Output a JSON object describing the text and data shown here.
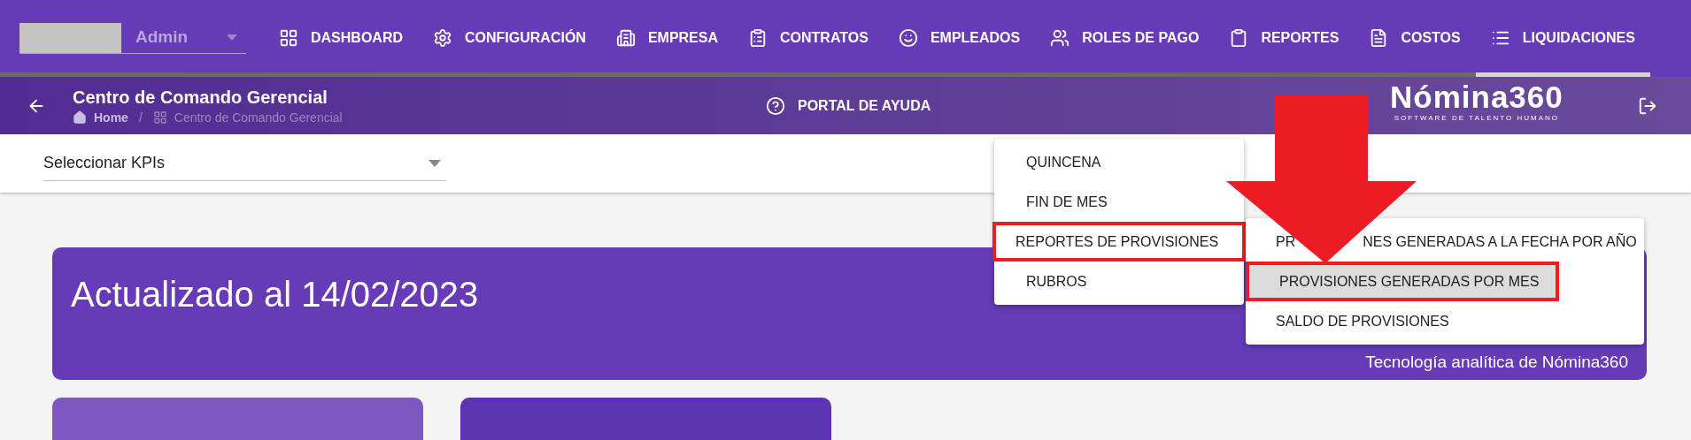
{
  "user_menu": {
    "value": "Admin"
  },
  "nav": [
    {
      "label": "DASHBOARD",
      "selected": false
    },
    {
      "label": "CONFIGURACIÓN",
      "selected": false
    },
    {
      "label": "EMPRESA",
      "selected": false
    },
    {
      "label": "CONTRATOS",
      "selected": false
    },
    {
      "label": "EMPLEADOS",
      "selected": false
    },
    {
      "label": "ROLES DE PAGO",
      "selected": false
    },
    {
      "label": "REPORTES",
      "selected": false
    },
    {
      "label": "COSTOS",
      "selected": false
    },
    {
      "label": "LIQUIDACIONES",
      "selected": true
    }
  ],
  "header": {
    "title": "Centro de Comando Gerencial",
    "breadcrumb": [
      "Home",
      "Centro de Comando Gerencial"
    ],
    "breadcrumb_separator": "/",
    "help": "PORTAL DE AYUDA",
    "logo": "Nómina360",
    "logo_tagline": "SOFTWARE DE TALENTO HUMANO"
  },
  "kpi_select": {
    "placeholder": "Seleccionar KPIs"
  },
  "banner": {
    "title": "Actualizado al 14/02/2023",
    "footer": "Tecnología analítica de Nómina360"
  },
  "menu": [
    {
      "label": "QUINCENA",
      "marked": false
    },
    {
      "label": "FIN DE MES",
      "marked": false
    },
    {
      "label": "REPORTES DE PROVISIONES",
      "marked": true
    },
    {
      "label": "RUBROS",
      "marked": false
    }
  ],
  "submenu": [
    {
      "label_parts": [
        "PR",
        "NES GENERADAS A LA FECHA POR AÑO"
      ],
      "selected": false,
      "marked": false
    },
    {
      "label_parts": [
        "PROVISIONES GENERADAS POR MES"
      ],
      "selected": true,
      "marked": true
    },
    {
      "label_parts": [
        "SALDO DE PROVISIONES"
      ],
      "selected": false,
      "marked": false
    }
  ]
}
